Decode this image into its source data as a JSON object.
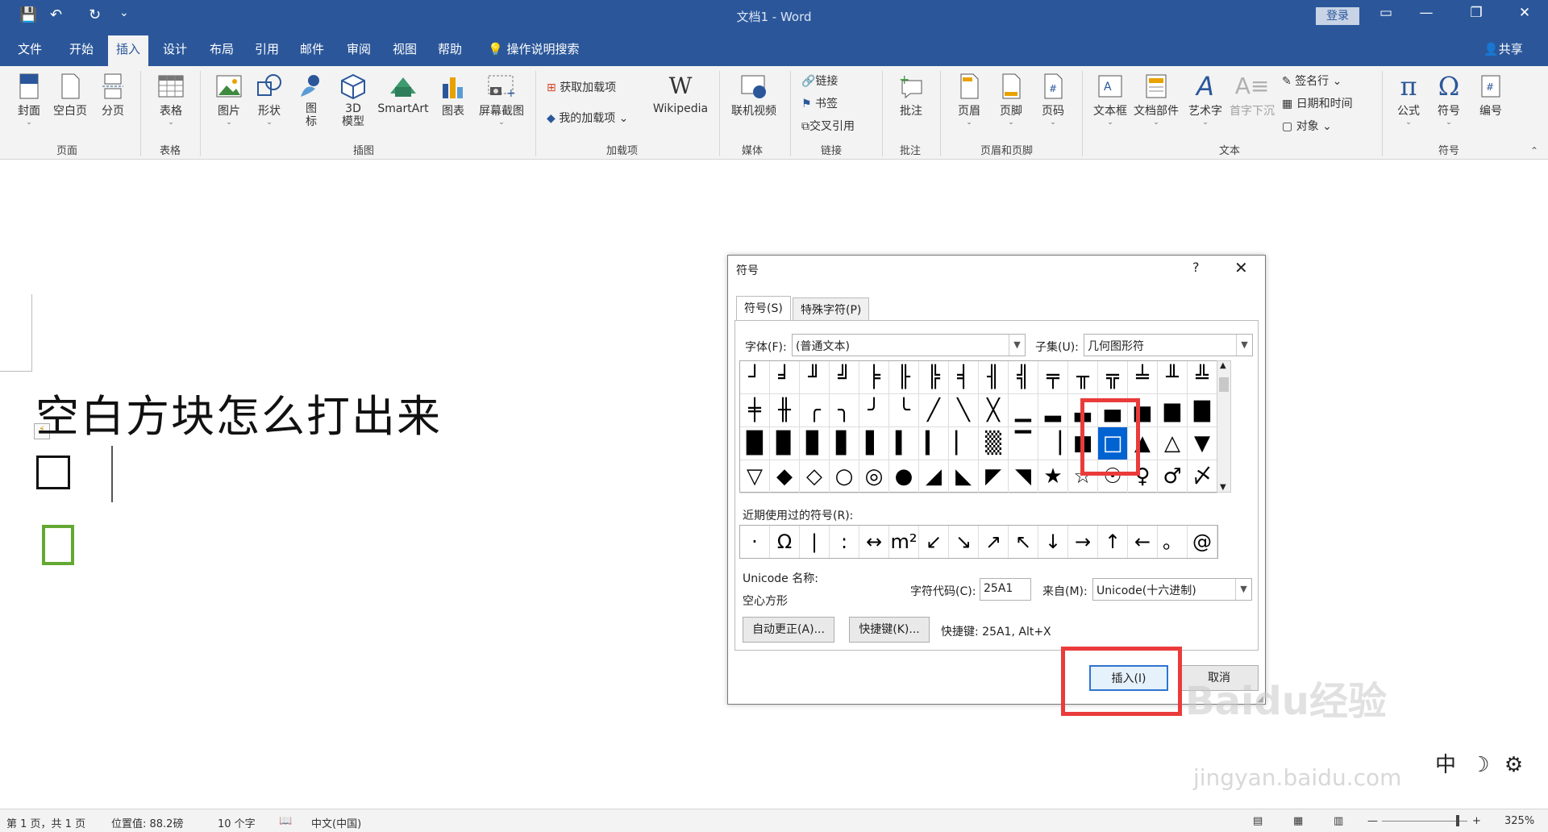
{
  "titlebar": {
    "doc_title": "文档1 - Word",
    "login": "登录",
    "qa_save": "💾",
    "qa_undo": "↶",
    "qa_redo": "↻",
    "qa_more": "⌄"
  },
  "tabs": [
    "文件",
    "开始",
    "插入",
    "设计",
    "布局",
    "引用",
    "邮件",
    "审阅",
    "视图",
    "帮助"
  ],
  "active_tab": "插入",
  "search_label": "操作说明搜索",
  "share_label": "共享",
  "ribbon": {
    "pages": [
      "封面",
      "空白页",
      "分页"
    ],
    "pages_group": "页面",
    "table": "表格",
    "table_group": "表格",
    "illus": [
      "图片",
      "形状",
      "图\n标",
      "3D\n模型",
      "SmartArt",
      "图表",
      "屏幕截图"
    ],
    "illus_group": "插图",
    "addins": [
      "获取加载项",
      "我的加载项"
    ],
    "wikipedia": "Wikipedia",
    "addins_group": "加载项",
    "media": "联机视频",
    "media_group": "媒体",
    "links": [
      "链接",
      "书签",
      "交叉引用"
    ],
    "links_group": "链接",
    "comment": "批注",
    "comment_group": "批注",
    "hf": [
      "页眉",
      "页脚",
      "页码"
    ],
    "hf_group": "页眉和页脚",
    "text": [
      "文本框",
      "文档部件",
      "艺术字",
      "首字下沉"
    ],
    "text_small": [
      "签名行",
      "日期和时间",
      "对象"
    ],
    "text_group": "文本",
    "sym": [
      "公式",
      "符号",
      "编号"
    ],
    "sym_group": "符号"
  },
  "document": {
    "heading": "空白方块怎么打出来"
  },
  "dialog": {
    "title": "符号",
    "help": "?",
    "close": "✕",
    "tab_symbols": "符号(S)",
    "tab_special": "特殊字符(P)",
    "font_label": "字体(F):",
    "font_value": "(普通文本)",
    "subset_label": "子集(U):",
    "subset_value": "几何图形符",
    "grid": [
      [
        "┘",
        "╛",
        "╜",
        "╝",
        "╞",
        "╟",
        "╠",
        "╡",
        "╢",
        "╣",
        "╤",
        "╥",
        "╦",
        "╧",
        "╨",
        "╩"
      ],
      [
        "╪",
        "╫",
        "╭",
        "╮",
        "╯",
        "╰",
        "╱",
        "╲",
        "╳",
        "▁",
        "▂",
        "▃",
        "▄",
        "▅",
        "▆",
        "▇"
      ],
      [
        "█",
        "▉",
        "▊",
        "▋",
        "▌",
        "▍",
        "▎",
        "▏",
        "▒",
        "▔",
        "▕",
        "■",
        "□",
        "▲",
        "△",
        "▼"
      ],
      [
        "▽",
        "◆",
        "◇",
        "○",
        "◎",
        "●",
        "◢",
        "◣",
        "◤",
        "◥",
        "★",
        "☆",
        "☉",
        "♀",
        "♂",
        "〆"
      ]
    ],
    "selected_symbol": "□",
    "recent_label": "近期使用过的符号(R):",
    "recent": [
      "·",
      "Ω",
      "|",
      ":",
      "↔",
      "m²",
      "↙",
      "↘",
      "↗",
      "↖",
      "↓",
      "→",
      "↑",
      "←",
      "。",
      "@"
    ],
    "unicode_name_label": "Unicode 名称:",
    "unicode_name": "空心方形",
    "code_label": "字符代码(C):",
    "code_value": "25A1",
    "from_label": "来自(M):",
    "from_value": "Unicode(十六进制)",
    "autocorrect_btn": "自动更正(A)...",
    "shortcut_btn": "快捷键(K)...",
    "shortcut_text": "快捷键: 25A1, Alt+X",
    "insert_btn": "插入(I)",
    "cancel_btn": "取消"
  },
  "status": {
    "page": "第 1 页，共 1 页",
    "position": "位置值: 88.2磅",
    "words": "10 个字",
    "language": "中文(中国)",
    "zoom": "325%"
  },
  "watermark": "Baidu经验",
  "watermark_url": "jingyan.baidu.com",
  "ime": "中"
}
